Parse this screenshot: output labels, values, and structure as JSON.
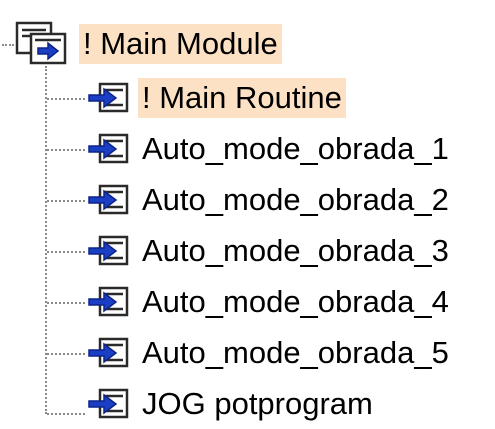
{
  "tree": {
    "root": {
      "label": "! Main Module",
      "icon": "module-icon",
      "highlighted": true
    },
    "children": [
      {
        "label": "! Main Routine",
        "icon": "routine-icon",
        "highlighted": true
      },
      {
        "label": "Auto_mode_obrada_1",
        "icon": "routine-icon",
        "highlighted": false
      },
      {
        "label": "Auto_mode_obrada_2",
        "icon": "routine-icon",
        "highlighted": false
      },
      {
        "label": "Auto_mode_obrada_3",
        "icon": "routine-icon",
        "highlighted": false
      },
      {
        "label": "Auto_mode_obrada_4",
        "icon": "routine-icon",
        "highlighted": false
      },
      {
        "label": "Auto_mode_obrada_5",
        "icon": "routine-icon",
        "highlighted": false
      },
      {
        "label": "JOG potprogram",
        "icon": "routine-icon",
        "highlighted": false
      }
    ]
  },
  "colors": {
    "highlight": "#fde1c4",
    "connector": "#8a8a8a",
    "icon_blue": "#1a3fc4"
  }
}
